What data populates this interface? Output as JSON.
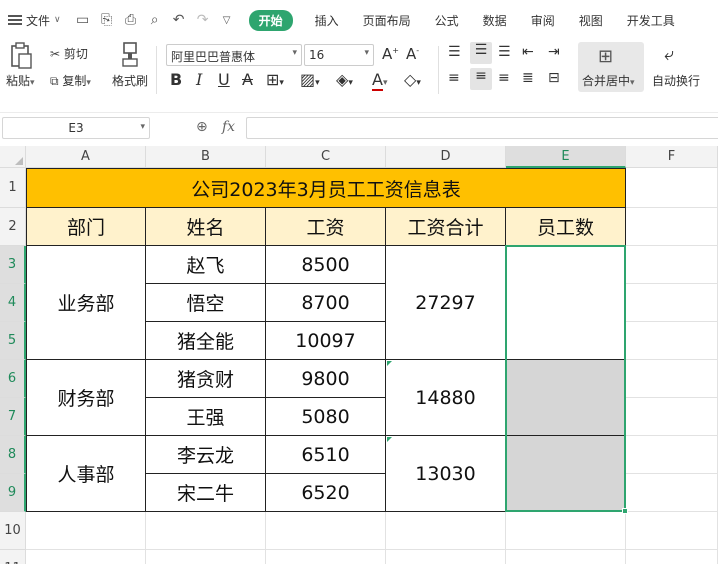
{
  "menu": {
    "file_label": "文件",
    "tabs": [
      {
        "label": "开始",
        "active": true
      },
      {
        "label": "插入",
        "active": false
      },
      {
        "label": "页面布局",
        "active": false
      },
      {
        "label": "公式",
        "active": false
      },
      {
        "label": "数据",
        "active": false
      },
      {
        "label": "审阅",
        "active": false
      },
      {
        "label": "视图",
        "active": false
      },
      {
        "label": "开发工具",
        "active": false
      }
    ]
  },
  "ribbon": {
    "cut": "剪切",
    "paste": "粘贴",
    "copy": "复制",
    "format_painter": "格式刷",
    "font_name": "阿里巴巴普惠体",
    "font_size": "16",
    "merge_center": "合并居中",
    "wrap_text": "自动换行"
  },
  "formula_bar": {
    "name_box": "E3",
    "fx": "fx",
    "value": ""
  },
  "colors": {
    "accent": "#2ea56f",
    "title_fill": "#ffc000",
    "header_fill": "#fff2cc",
    "merged_gray": "#d6d6d6"
  },
  "sheet": {
    "columns": [
      "A",
      "B",
      "C",
      "D",
      "E",
      "F"
    ],
    "rows": [
      "1",
      "2",
      "3",
      "4",
      "5",
      "6",
      "7",
      "8",
      "9",
      "10",
      "11"
    ],
    "selected_column": "E",
    "title": "公司2023年3月员工工资信息表",
    "headers": [
      "部门",
      "姓名",
      "工资",
      "工资合计",
      "员工数"
    ],
    "departments": [
      {
        "name": "业务部",
        "employees": [
          {
            "name": "赵飞",
            "salary": "8500"
          },
          {
            "name": "悟空",
            "salary": "8700"
          },
          {
            "name": "猪全能",
            "salary": "10097"
          }
        ],
        "total": "27297",
        "count": ""
      },
      {
        "name": "财务部",
        "employees": [
          {
            "name": "猪贪财",
            "salary": "9800"
          },
          {
            "name": "王强",
            "salary": "5080"
          }
        ],
        "total": "14880",
        "count": ""
      },
      {
        "name": "人事部",
        "employees": [
          {
            "name": "李云龙",
            "salary": "6510"
          },
          {
            "name": "宋二牛",
            "salary": "6520"
          }
        ],
        "total": "13030",
        "count": ""
      }
    ]
  }
}
